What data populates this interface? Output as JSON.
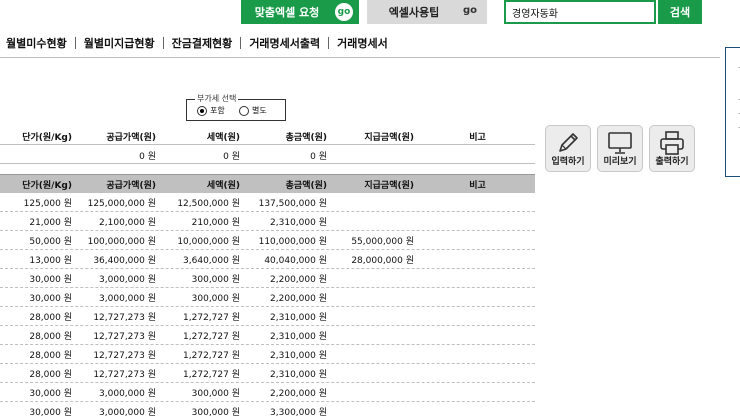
{
  "topbar": {
    "custom_excel_label": "맞춤엑셀 요청",
    "custom_excel_go": "go",
    "excel_tips_label": "엑셀사용팁",
    "excel_tips_go": "go",
    "search_value": "경영자동화",
    "search_button": "검색"
  },
  "nav": {
    "items": [
      "월별미수현황",
      "월별미지급현황",
      "잔금결제현황",
      "거래명세서출력",
      "거래명세서"
    ]
  },
  "vat": {
    "legend": "부가세 선택",
    "option_included": "포함",
    "option_separate": "별도"
  },
  "summary_header": [
    "단가(원/Kg)",
    "공급가액(원)",
    "세액(원)",
    "총금액(원)",
    "지급금액(원)",
    "비고"
  ],
  "summary_row": [
    "",
    "0 원",
    "0 원",
    "0 원",
    "",
    ""
  ],
  "table": {
    "headers": [
      "단가(원/Kg)",
      "공급가액(원)",
      "세액(원)",
      "총금액(원)",
      "지급금액(원)",
      "비고"
    ],
    "rows": [
      [
        "125,000 원",
        "125,000,000 원",
        "12,500,000 원",
        "137,500,000 원",
        "",
        ""
      ],
      [
        "21,000 원",
        "2,100,000 원",
        "210,000 원",
        "2,310,000 원",
        "",
        ""
      ],
      [
        "50,000 원",
        "100,000,000 원",
        "10,000,000 원",
        "110,000,000 원",
        "55,000,000 원",
        ""
      ],
      [
        "13,000 원",
        "36,400,000 원",
        "3,640,000 원",
        "40,040,000 원",
        "28,000,000 원",
        ""
      ],
      [
        "30,000 원",
        "3,000,000 원",
        "300,000 원",
        "2,200,000 원",
        "",
        ""
      ],
      [
        "30,000 원",
        "3,000,000 원",
        "300,000 원",
        "2,200,000 원",
        "",
        ""
      ],
      [
        "28,000 원",
        "12,727,273 원",
        "1,272,727 원",
        "2,310,000 원",
        "",
        ""
      ],
      [
        "28,000 원",
        "12,727,273 원",
        "1,272,727 원",
        "2,310,000 원",
        "",
        ""
      ],
      [
        "28,000 원",
        "12,727,273 원",
        "1,272,727 원",
        "2,310,000 원",
        "",
        ""
      ],
      [
        "28,000 원",
        "12,727,273 원",
        "1,272,727 원",
        "2,310,000 원",
        "",
        ""
      ],
      [
        "30,000 원",
        "3,000,000 원",
        "300,000 원",
        "2,200,000 원",
        "",
        ""
      ],
      [
        "30,000 원",
        "3,000,000 원",
        "300,000 원",
        "3,300,000 원",
        "",
        ""
      ]
    ]
  },
  "actions": {
    "input_label": "입력하기",
    "preview_label": "미리보기",
    "print_label": "출력하기"
  },
  "icons": {
    "input": "pencil-icon",
    "preview": "monitor-icon",
    "print": "printer-icon"
  },
  "colors": {
    "accent_green": "#1a9b4a",
    "header_gray": "#c0c0c0",
    "side_panel_border": "#1f4e79"
  }
}
